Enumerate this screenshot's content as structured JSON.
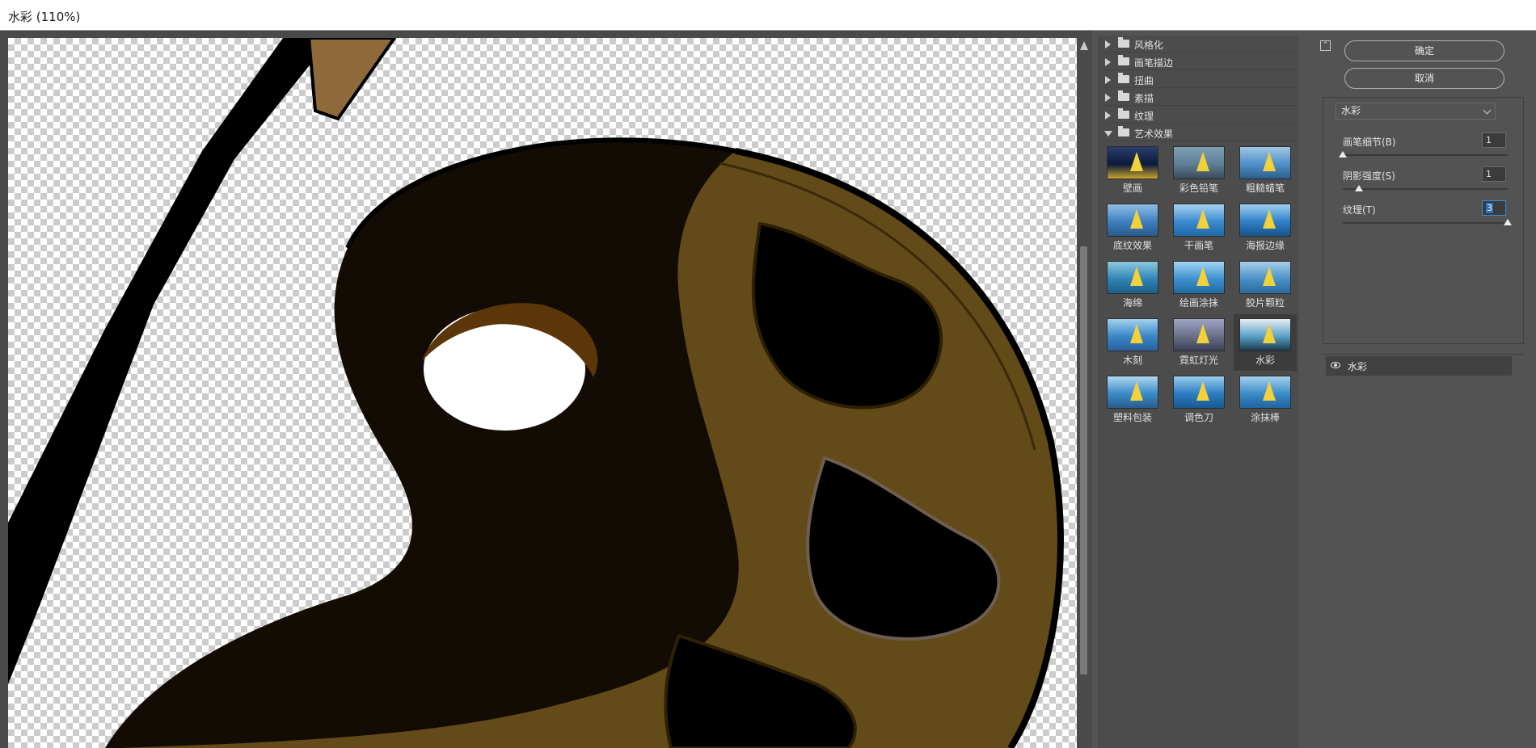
{
  "window": {
    "title": "水彩 (110%)"
  },
  "filter_categories": [
    {
      "label": "风格化",
      "open": false
    },
    {
      "label": "画笔描边",
      "open": false
    },
    {
      "label": "扭曲",
      "open": false
    },
    {
      "label": "素描",
      "open": false
    },
    {
      "label": "纹理",
      "open": false
    },
    {
      "label": "艺术效果",
      "open": true
    }
  ],
  "artistic_filters": [
    {
      "label": "壁画",
      "selected": false
    },
    {
      "label": "彩色铅笔",
      "selected": false
    },
    {
      "label": "粗糙蜡笔",
      "selected": false
    },
    {
      "label": "底纹效果",
      "selected": false
    },
    {
      "label": "干画笔",
      "selected": false
    },
    {
      "label": "海报边缘",
      "selected": false
    },
    {
      "label": "海绵",
      "selected": false
    },
    {
      "label": "绘画涂抹",
      "selected": false
    },
    {
      "label": "胶片颗粒",
      "selected": false
    },
    {
      "label": "木刻",
      "selected": false
    },
    {
      "label": "霓虹灯光",
      "selected": false
    },
    {
      "label": "水彩",
      "selected": true
    },
    {
      "label": "塑料包装",
      "selected": false
    },
    {
      "label": "调色刀",
      "selected": false
    },
    {
      "label": "涂抹棒",
      "selected": false
    }
  ],
  "buttons": {
    "ok": "确定",
    "cancel": "取消"
  },
  "settings": {
    "filter_select": "水彩",
    "params": [
      {
        "label": "画笔细节(B)",
        "value": "1",
        "fraction": 0.0
      },
      {
        "label": "阴影强度(S)",
        "value": "1",
        "fraction": 0.1
      },
      {
        "label": "纹理(T)",
        "value": "3",
        "fraction": 1.0
      }
    ]
  },
  "layers": [
    {
      "name": "水彩"
    }
  ],
  "colors": {
    "panel": "#535353",
    "accent": "#2f8fdd",
    "palette_dark": "#130c04",
    "palette_olive": "#634a19"
  }
}
